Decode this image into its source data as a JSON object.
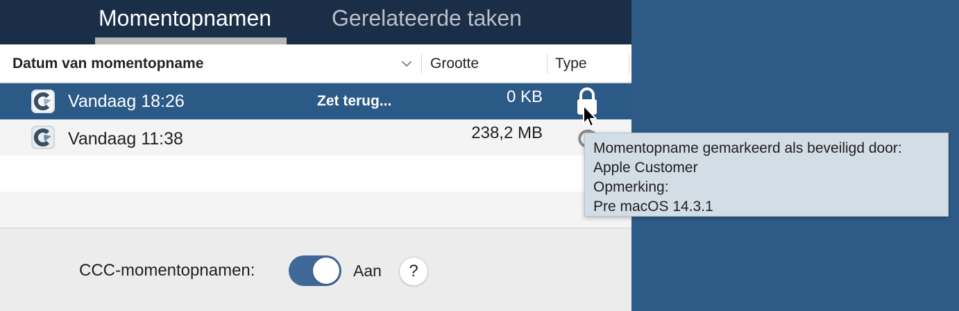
{
  "tabs": {
    "active_label": "Momentopnamen",
    "inactive_label": "Gerelateerde taken"
  },
  "table": {
    "headers": {
      "date": "Datum van momentopname",
      "size": "Grootte",
      "type": "Type"
    },
    "rows": [
      {
        "date": "Vandaag 18:26",
        "action": "Zet terug...",
        "size": "0 KB",
        "type_icon": "lock-icon",
        "selected": true
      },
      {
        "date": "Vandaag 11:38",
        "size": "238,2 MB",
        "type_icon": "refresh-icon",
        "selected": false
      }
    ]
  },
  "tooltip": {
    "line1": "Momentopname gemarkeerd als beveiligd door:",
    "line2": "Apple Customer",
    "line3": "Opmerking:",
    "line4": "Pre macOS 14.3.1"
  },
  "footer": {
    "toggle_label": "CCC-momentopnamen:",
    "toggle_state": "Aan",
    "toggle_on": true,
    "help_label": "?"
  },
  "colors": {
    "header_bg": "#1b2e47",
    "selected_row": "#2b5a86",
    "desktop": "#2e5b87",
    "toggle_on": "#3d6898"
  }
}
